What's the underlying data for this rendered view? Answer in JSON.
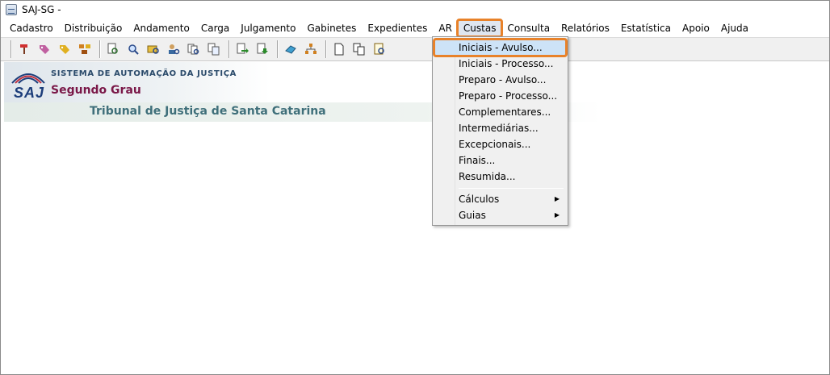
{
  "window": {
    "title": "SAJ-SG -"
  },
  "menubar": {
    "items": [
      {
        "label": "Cadastro"
      },
      {
        "label": "Distribuição"
      },
      {
        "label": "Andamento"
      },
      {
        "label": "Carga"
      },
      {
        "label": "Julgamento"
      },
      {
        "label": "Gabinetes"
      },
      {
        "label": "Expedientes"
      },
      {
        "label": "AR"
      },
      {
        "label": "Custas"
      },
      {
        "label": "Consulta"
      },
      {
        "label": "Relatórios"
      },
      {
        "label": "Estatística"
      },
      {
        "label": "Apoio"
      },
      {
        "label": "Ajuda"
      }
    ]
  },
  "banner": {
    "logo_text": "SAJ",
    "system_name": "SISTEMA DE AUTOMAÇÃO DA JUSTIÇA",
    "grau": "Segundo Grau",
    "tribunal": "Tribunal de Justiça de Santa Catarina"
  },
  "custas_menu": {
    "items": [
      {
        "label": "Iniciais - Avulso..."
      },
      {
        "label": "Iniciais - Processo..."
      },
      {
        "label": "Preparo - Avulso..."
      },
      {
        "label": "Preparo - Processo..."
      },
      {
        "label": "Complementares..."
      },
      {
        "label": "Intermediárias..."
      },
      {
        "label": "Excepcionais..."
      },
      {
        "label": "Finais..."
      },
      {
        "label": "Resumida..."
      }
    ],
    "submenus": [
      {
        "label": "Cálculos"
      },
      {
        "label": "Guias"
      }
    ]
  },
  "colors": {
    "highlight_outline": "#e8822a",
    "menu_highlight": "#cde3f7",
    "grau_text": "#7a1848",
    "tribunal_text": "#3f6f7a"
  }
}
